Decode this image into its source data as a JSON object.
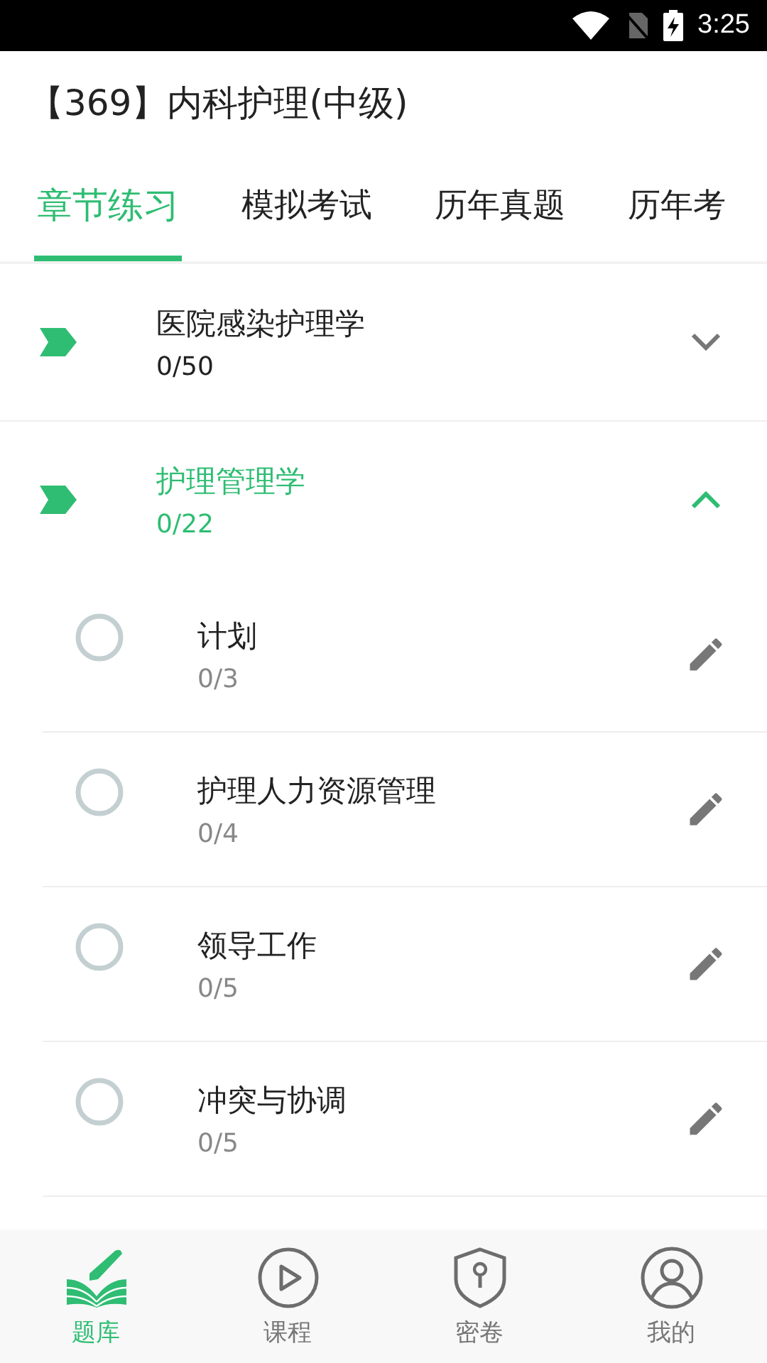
{
  "status_bar": {
    "time": "3:25"
  },
  "title": "【369】内科护理(中级)",
  "tabs": [
    {
      "label": "章节练习",
      "selected": true
    },
    {
      "label": "模拟考试",
      "selected": false
    },
    {
      "label": "历年真题",
      "selected": false
    },
    {
      "label": "历年考",
      "selected": false
    }
  ],
  "chapters": [
    {
      "title": "医院感染护理学",
      "count": "0/50",
      "expanded": false
    },
    {
      "title": "护理管理学",
      "count": "0/22",
      "expanded": true,
      "children": [
        {
          "title": "计划",
          "count": "0/3"
        },
        {
          "title": "护理人力资源管理",
          "count": "0/4"
        },
        {
          "title": "领导工作",
          "count": "0/5"
        },
        {
          "title": "冲突与协调",
          "count": "0/5"
        }
      ]
    }
  ],
  "bottom_nav": [
    {
      "label": "题库",
      "selected": true
    },
    {
      "label": "课程",
      "selected": false
    },
    {
      "label": "密卷",
      "selected": false
    },
    {
      "label": "我的",
      "selected": false
    }
  ]
}
